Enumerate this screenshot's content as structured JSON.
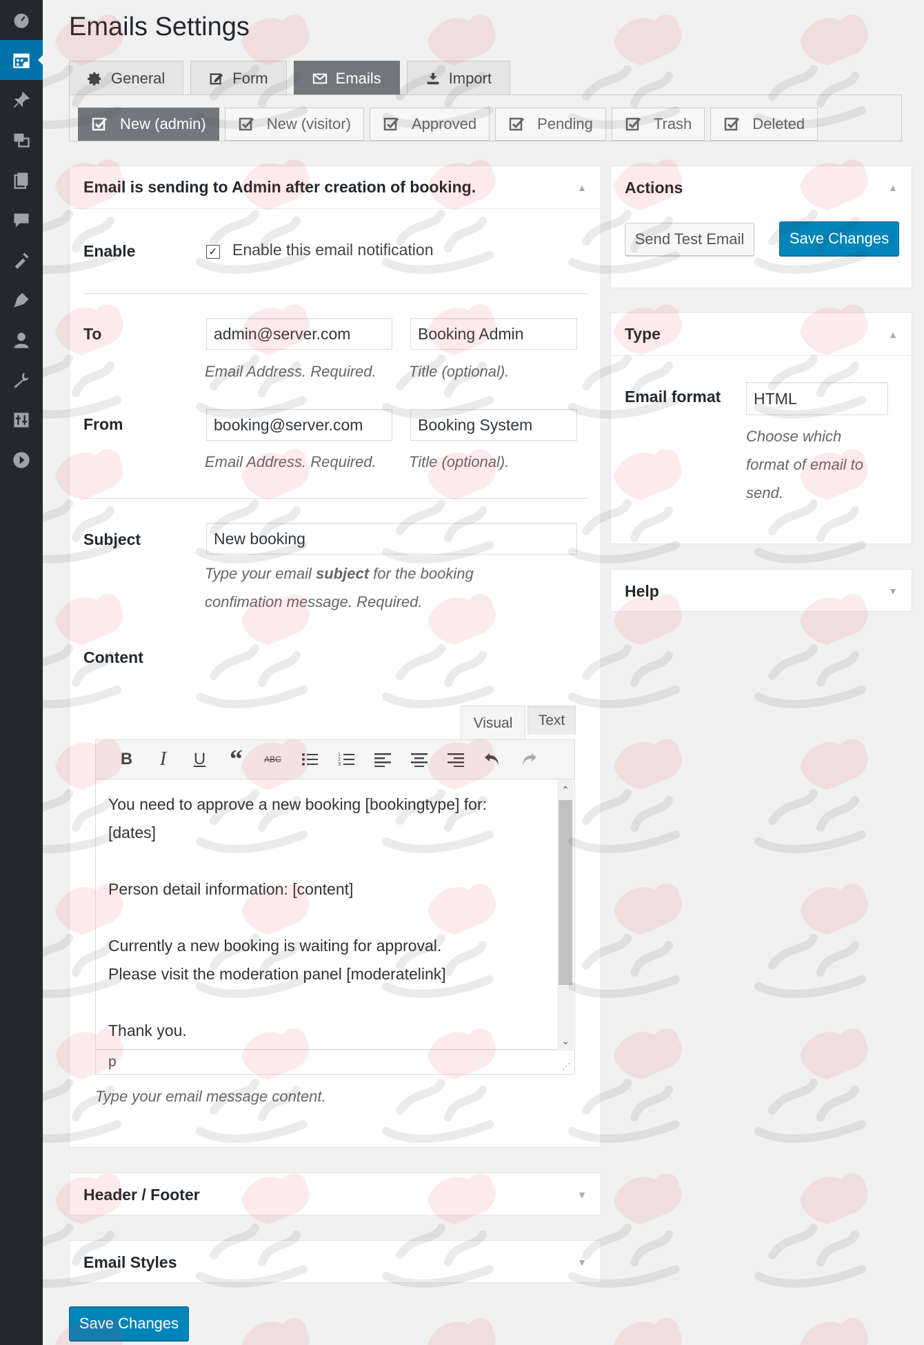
{
  "sidebar": {
    "icons": [
      "dashboard-icon",
      "calendar-icon",
      "pin-icon",
      "media-icon",
      "pages-icon",
      "comments-icon",
      "appearance-icon",
      "plugins-icon",
      "users-icon",
      "tools-icon",
      "settings-icon",
      "play-icon"
    ],
    "active_index": 1
  },
  "page": {
    "title": "Emails Settings"
  },
  "tabs": [
    {
      "label": "General",
      "icon": "gear-icon"
    },
    {
      "label": "Form",
      "icon": "edit-icon"
    },
    {
      "label": "Emails",
      "icon": "email-icon"
    },
    {
      "label": "Import",
      "icon": "import-icon"
    }
  ],
  "active_tab": 2,
  "subtabs": [
    {
      "label": "New (admin)"
    },
    {
      "label": "New (visitor)"
    },
    {
      "label": "Approved"
    },
    {
      "label": "Pending"
    },
    {
      "label": "Trash"
    },
    {
      "label": "Deleted"
    }
  ],
  "active_subtab": 0,
  "main_box": {
    "title": "Email is sending to Admin after creation of booking.",
    "enable": {
      "label": "Enable",
      "checkbox_label": "Enable this email notification",
      "checked": true
    },
    "to": {
      "label": "To",
      "email_value": "admin@server.com",
      "title_value": "Booking Admin",
      "email_desc": "Email Address. Required.",
      "title_desc": "Title (optional)."
    },
    "from": {
      "label": "From",
      "email_value": "booking@server.com",
      "title_value": "Booking System",
      "email_desc": "Email Address. Required.",
      "title_desc": "Title (optional)."
    },
    "subject": {
      "label": "Subject",
      "value": "New booking",
      "desc_before": "Type your email",
      "desc_bold": "subject",
      "desc_after": "for the booking",
      "desc_line2": "confimation message. Required."
    },
    "content": {
      "label": "Content",
      "tab_visual": "Visual",
      "tab_text": "Text",
      "lines": [
        "You need to approve a new booking [bookingtype] for:",
        "[dates]",
        "",
        "Person detail information:  [content]",
        "",
        "Currently a new booking is waiting for approval.",
        "Please visit the moderation panel [moderatelink]",
        "",
        "Thank you."
      ],
      "status_path": "p",
      "desc": "Type your email message content."
    }
  },
  "header_footer": {
    "title": "Header / Footer"
  },
  "email_styles": {
    "title": "Email Styles"
  },
  "actions": {
    "title": "Actions",
    "send_test_label": "Send Test Email",
    "save_label": "Save Changes"
  },
  "type_box": {
    "title": "Type",
    "format_label": "Email format",
    "format_value": "HTML",
    "desc_line1": "Choose which",
    "desc_line2": "format of email to",
    "desc_line3": "send."
  },
  "help_box": {
    "title": "Help"
  },
  "bottom_save_label": "Save Changes"
}
